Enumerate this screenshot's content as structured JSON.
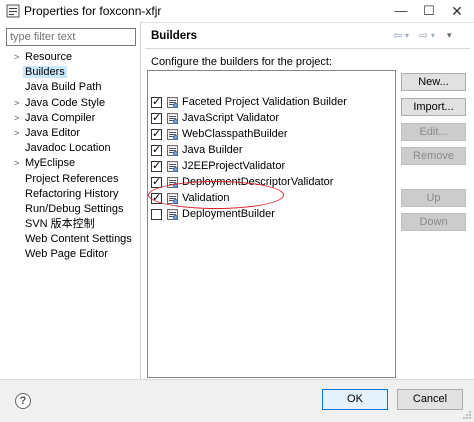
{
  "window": {
    "title": "Properties for foxconn-xfjr",
    "minimize": "—",
    "maximize": "☐",
    "close": "✕",
    "icon": "properties-icon"
  },
  "sidebar": {
    "filter_placeholder": "type filter text",
    "items": [
      {
        "label": "Resource",
        "expandable": true
      },
      {
        "label": "Builders",
        "expandable": false,
        "selected": true
      },
      {
        "label": "Java Build Path",
        "expandable": false
      },
      {
        "label": "Java Code Style",
        "expandable": true
      },
      {
        "label": "Java Compiler",
        "expandable": true
      },
      {
        "label": "Java Editor",
        "expandable": true
      },
      {
        "label": "Javadoc Location",
        "expandable": false
      },
      {
        "label": "MyEclipse",
        "expandable": true
      },
      {
        "label": "Project References",
        "expandable": false
      },
      {
        "label": "Refactoring History",
        "expandable": false
      },
      {
        "label": "Run/Debug Settings",
        "expandable": false
      },
      {
        "label": "SVN 版本控制",
        "expandable": false
      },
      {
        "label": "Web Content Settings",
        "expandable": false
      },
      {
        "label": "Web Page Editor",
        "expandable": false
      }
    ]
  },
  "main": {
    "title": "Builders",
    "nav": {
      "back": "⇦",
      "back_menu": "▾",
      "forward": "⇨",
      "forward_menu": "▾",
      "menu": "▾"
    },
    "description": "Configure the builders for the project:",
    "builders": [
      {
        "label": "Faceted Project Validation Builder",
        "checked": true
      },
      {
        "label": "JavaScript Validator",
        "checked": true
      },
      {
        "label": "WebClasspathBuilder",
        "checked": true
      },
      {
        "label": "Java Builder",
        "checked": true
      },
      {
        "label": "J2EEProjectValidator",
        "checked": true
      },
      {
        "label": "DeploymentDescriptorValidator",
        "checked": true
      },
      {
        "label": "Validation",
        "checked": true
      },
      {
        "label": "DeploymentBuilder",
        "checked": false,
        "highlighted": true
      }
    ],
    "buttons": {
      "new": "New...",
      "import": "Import...",
      "edit": "Edit...",
      "remove": "Remove",
      "up": "Up",
      "down": "Down"
    },
    "highlight_color": "#d9232a"
  },
  "footer": {
    "help": "?",
    "ok": "OK",
    "cancel": "Cancel"
  }
}
